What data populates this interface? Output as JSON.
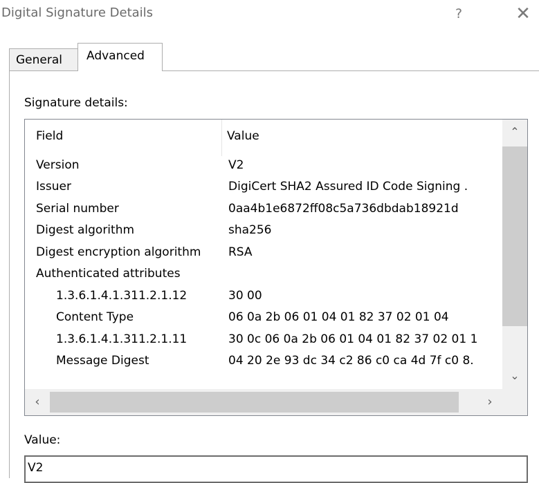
{
  "window": {
    "title": "Digital Signature Details",
    "help_glyph": "?",
    "close_glyph": "✕"
  },
  "tabs": [
    {
      "label": "General",
      "selected": false
    },
    {
      "label": "Advanced",
      "selected": true
    }
  ],
  "details": {
    "label": "Signature details:",
    "columns": [
      "Field",
      "Value"
    ],
    "rows": [
      {
        "field": "Version",
        "value": "V2"
      },
      {
        "field": "Issuer",
        "value": "DigiCert SHA2 Assured ID Code Signing ."
      },
      {
        "field": "Serial number",
        "value": "0aa4b1e6872ff08c5a736dbdab18921d"
      },
      {
        "field": "Digest algorithm",
        "value": "sha256"
      },
      {
        "field": "Digest encryption algorithm",
        "value": "RSA"
      },
      {
        "field": "Authenticated attributes",
        "value": ""
      },
      {
        "field": "1.3.6.1.4.1.311.2.1.12",
        "value": "30 00"
      },
      {
        "field": "Content Type",
        "value": "06 0a 2b 06 01 04 01 82 37 02 01 04"
      },
      {
        "field": "1.3.6.1.4.1.311.2.1.11",
        "value": "30 0c 06 0a 2b 06 01 04 01 82 37 02 01 1"
      },
      {
        "field": "Message Digest",
        "value": "04 20 2e 93 dc 34 c2 86 c0 ca 4d 7f c0 8."
      }
    ]
  },
  "value_panel": {
    "label": "Value:",
    "text": "V2"
  },
  "scroll_glyphs": {
    "up": "⌃",
    "down": "⌄",
    "left": "‹",
    "right": "›"
  }
}
